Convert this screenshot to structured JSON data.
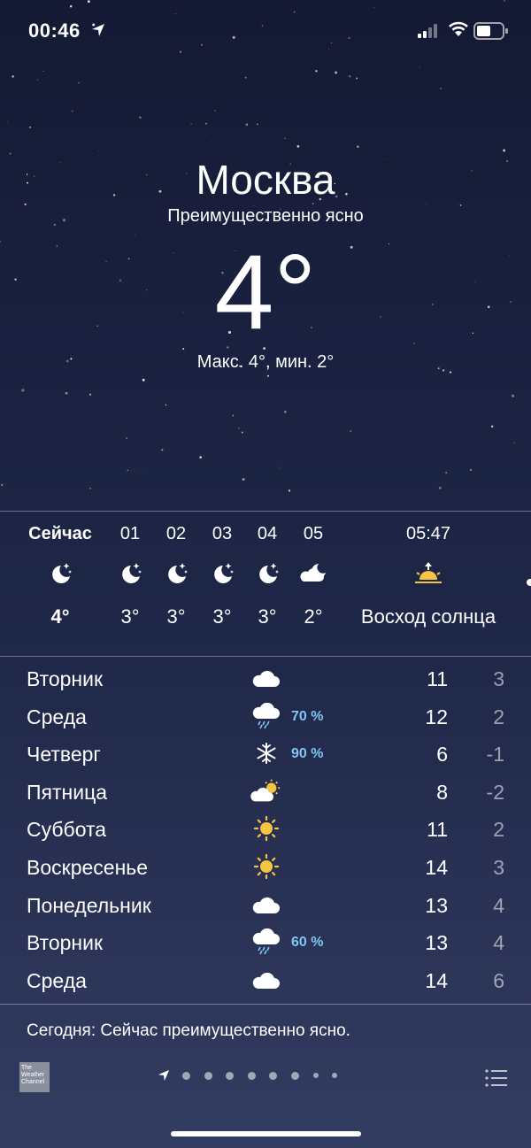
{
  "status_bar": {
    "time": "00:46"
  },
  "location": {
    "city": "Москва",
    "condition": "Преимущественно ясно",
    "temperature": "4°",
    "hi_lo": "Макс. 4°, мин. 2°"
  },
  "hourly": [
    {
      "label": "Сейчас",
      "icon": "moon-stars-icon",
      "temp": "4°",
      "bold": true
    },
    {
      "label": "01",
      "icon": "moon-stars-icon",
      "temp": "3°"
    },
    {
      "label": "02",
      "icon": "moon-stars-icon",
      "temp": "3°"
    },
    {
      "label": "03",
      "icon": "moon-stars-icon",
      "temp": "3°"
    },
    {
      "label": "04",
      "icon": "moon-stars-icon",
      "temp": "3°"
    },
    {
      "label": "05",
      "icon": "moon-cloud-icon",
      "temp": "2°"
    },
    {
      "label": "05:47",
      "icon": "sunrise-icon",
      "temp": "Восход солнца"
    }
  ],
  "daily": [
    {
      "day": "Вторник",
      "icon": "cloud-icon",
      "precip": "",
      "hi": "11",
      "lo": "3"
    },
    {
      "day": "Среда",
      "icon": "rain-icon",
      "precip": "70 %",
      "hi": "12",
      "lo": "2"
    },
    {
      "day": "Четверг",
      "icon": "snowflake-icon",
      "precip": "90 %",
      "hi": "6",
      "lo": "-1"
    },
    {
      "day": "Пятница",
      "icon": "partly-sunny-icon",
      "precip": "",
      "hi": "8",
      "lo": "-2"
    },
    {
      "day": "Суббота",
      "icon": "sun-icon",
      "precip": "",
      "hi": "11",
      "lo": "2"
    },
    {
      "day": "Воскресенье",
      "icon": "sun-icon",
      "precip": "",
      "hi": "14",
      "lo": "3"
    },
    {
      "day": "Понедельник",
      "icon": "cloud-icon",
      "precip": "",
      "hi": "13",
      "lo": "4"
    },
    {
      "day": "Вторник",
      "icon": "rain-icon",
      "precip": "60 %",
      "hi": "13",
      "lo": "4"
    },
    {
      "day": "Среда",
      "icon": "cloud-icon",
      "precip": "",
      "hi": "14",
      "lo": "6"
    }
  ],
  "today_summary": "Сегодня: Сейчас преимущественно ясно.",
  "footer": {
    "provider_logo": [
      "The",
      "Weather",
      "Channel"
    ],
    "page_count": 9
  },
  "colors": {
    "precip": "#7fc6f2",
    "sun": "#f5c542"
  }
}
